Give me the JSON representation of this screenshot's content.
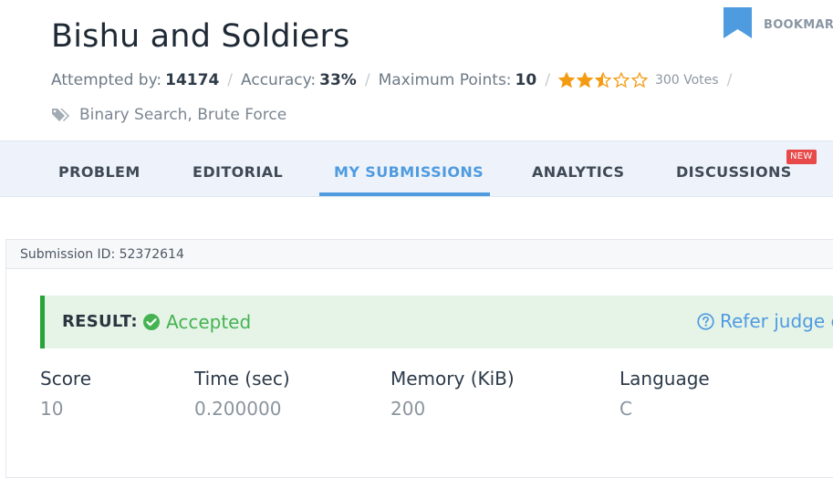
{
  "bookmark": {
    "label": "BOOKMAR",
    "icon": "bookmark-icon",
    "color": "#4f9be0"
  },
  "problem": {
    "title": "Bishu and Soldiers",
    "attempted_label": "Attempted by:",
    "attempted_value": "14174",
    "accuracy_label": "Accuracy:",
    "accuracy_value": "33%",
    "max_points_label": "Maximum Points:",
    "max_points_value": "10",
    "rating": 2.5,
    "rating_max": 5,
    "votes": "300 Votes",
    "separator": "/",
    "tags_icon": "tag-icon",
    "tags": "Binary Search, Brute Force"
  },
  "tabs": [
    {
      "label": "PROBLEM",
      "active": false
    },
    {
      "label": "EDITORIAL",
      "active": false
    },
    {
      "label": "MY SUBMISSIONS",
      "active": true
    },
    {
      "label": "ANALYTICS",
      "active": false
    },
    {
      "label": "DISCUSSIONS",
      "active": false,
      "badge": "NEW"
    }
  ],
  "submission": {
    "id_text": "Submission ID: 52372614",
    "result_label": "RESULT:",
    "result_value": "Accepted",
    "result_icon": "check-circle-icon",
    "refer_text": "Refer judge e",
    "refer_icon": "question-circle-icon",
    "stats": [
      {
        "label": "Score",
        "value": "10"
      },
      {
        "label": "Time (sec)",
        "value": "0.200000"
      },
      {
        "label": "Memory (KiB)",
        "value": "200"
      },
      {
        "label": "Language",
        "value": "C"
      }
    ]
  },
  "colors": {
    "accent": "#4f9be0",
    "success": "#26a33a",
    "star": "#f39c12",
    "badge": "#e84a4a"
  }
}
